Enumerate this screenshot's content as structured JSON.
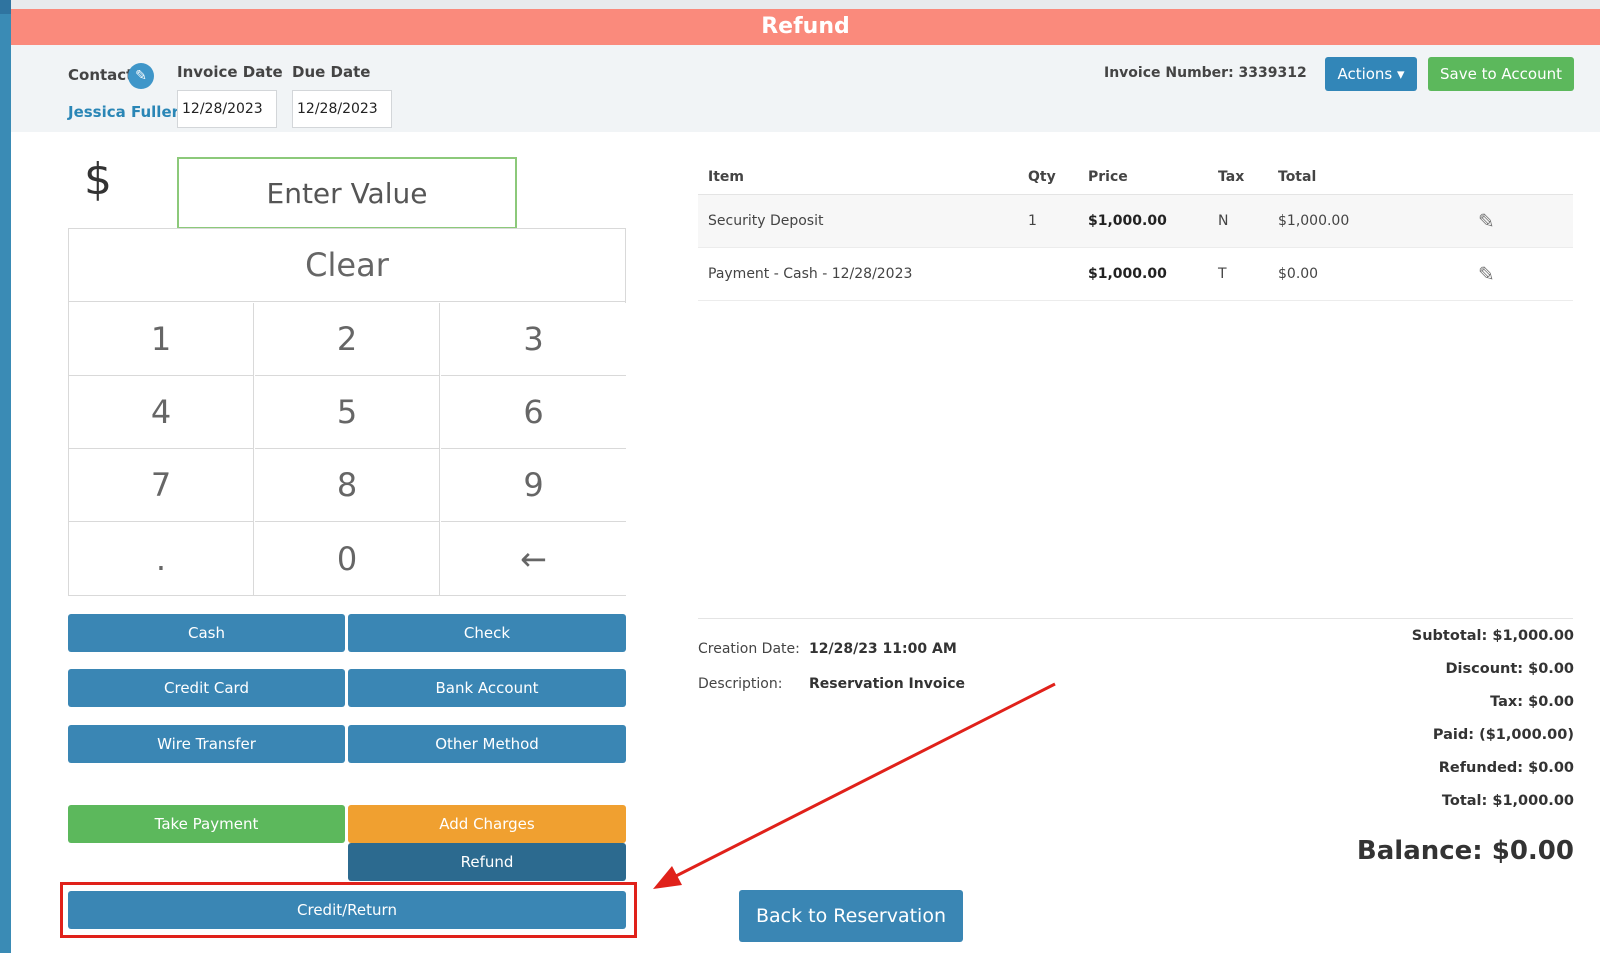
{
  "title": "Refund",
  "header": {
    "contact_label": "Contact",
    "contact_name": "Jessica Fuller",
    "invoice_date_label": "Invoice Date",
    "invoice_date": "12/28/2023",
    "due_date_label": "Due Date",
    "due_date": "12/28/2023",
    "invoice_number": "Invoice Number: 3339312",
    "actions_label": "Actions ▾",
    "save_label": "Save to Account"
  },
  "keypad": {
    "currency_symbol": "$",
    "value_placeholder": "Enter Value",
    "clear": "Clear",
    "keys": [
      "1",
      "2",
      "3",
      "4",
      "5",
      "6",
      "7",
      "8",
      "9",
      ".",
      "0",
      "←"
    ]
  },
  "payment_methods": {
    "cash": "Cash",
    "check": "Check",
    "credit_card": "Credit Card",
    "bank_account": "Bank Account",
    "wire_transfer": "Wire Transfer",
    "other_method": "Other Method"
  },
  "actions": {
    "take_payment": "Take Payment",
    "add_charges": "Add Charges",
    "refund": "Refund",
    "credit_return": "Credit/Return"
  },
  "table": {
    "headers": [
      "Item",
      "Qty",
      "Price",
      "Tax",
      "Total"
    ],
    "rows": [
      {
        "item": "Security Deposit",
        "qty": "1",
        "price": "$1,000.00",
        "tax": "N",
        "total": "$1,000.00"
      },
      {
        "item": "Payment - Cash - 12/28/2023",
        "qty": "",
        "price": "$1,000.00",
        "tax": "T",
        "total": "$0.00"
      }
    ]
  },
  "meta": {
    "creation_date_label": "Creation Date:",
    "creation_date": "12/28/23 11:00 AM",
    "description_label": "Description:",
    "description": "Reservation Invoice"
  },
  "totals": {
    "subtotal": "Subtotal: $1,000.00",
    "discount": "Discount: $0.00",
    "tax": "Tax: $0.00",
    "paid": "Paid: ($1,000.00)",
    "refunded": "Refunded: $0.00",
    "total": "Total: $1,000.00",
    "balance": "Balance: $0.00"
  },
  "back_label": "Back to Reservation",
  "colors": {
    "title_bar": "#fa8a7c",
    "primary": "#3a86b4",
    "success": "#5cb85c",
    "warning": "#f0a030",
    "annotation": "#e0211a"
  }
}
